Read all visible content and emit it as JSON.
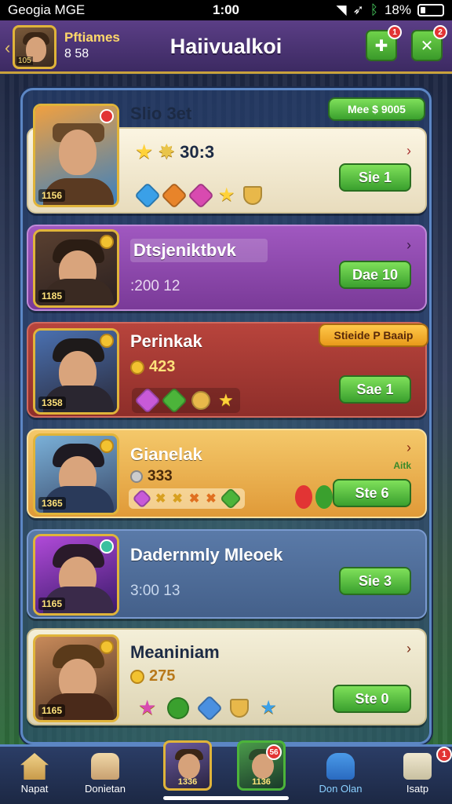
{
  "status_bar": {
    "carrier": "Geogia MGE",
    "time": "1:00",
    "battery": "18%"
  },
  "header": {
    "player_name": "Pftiames",
    "player_score": "8 58",
    "title": "Haiivualkoi",
    "button_badges": [
      "1",
      "2"
    ]
  },
  "cards": [
    {
      "name": "Slio 3et",
      "value": "30:3",
      "level": "1156",
      "button": "Sie 1",
      "tag": "Mee $ 9005",
      "bg": "#f3ead2"
    },
    {
      "name": "Dtsjeniktbvk",
      "value": ":200 12",
      "level": "1185",
      "button": "Dae 10",
      "bg": "#8b4aa8"
    },
    {
      "name": "Perinkak",
      "value": "423",
      "level": "1358",
      "button": "Sae 1",
      "tag": "Stieide P Baaip",
      "bg": "#a83a34"
    },
    {
      "name": "Gianelak",
      "value": "333",
      "level": "1365",
      "button": "Ste 6",
      "tag": "Aitk",
      "bg": "#e8a94a"
    },
    {
      "name": "Dadernmly Mleoek",
      "value": "3:00 13",
      "level": "1165",
      "button": "Sie 3",
      "bg": "#4f6e9a"
    },
    {
      "name": "Meaniniam",
      "value": "275",
      "level": "1165",
      "button": "Ste 0",
      "bg": "#ece7cf"
    }
  ],
  "bottom_nav": {
    "items": [
      "Napat",
      "Donietan",
      "Don Olan",
      "Isatp"
    ],
    "avatar_levels": [
      "1336",
      "1136"
    ],
    "badges": [
      "56",
      "1"
    ]
  },
  "colors": {
    "accent_green": "#4cb43a",
    "gold": "#e0b43a",
    "header_purple": "#4a3374"
  }
}
